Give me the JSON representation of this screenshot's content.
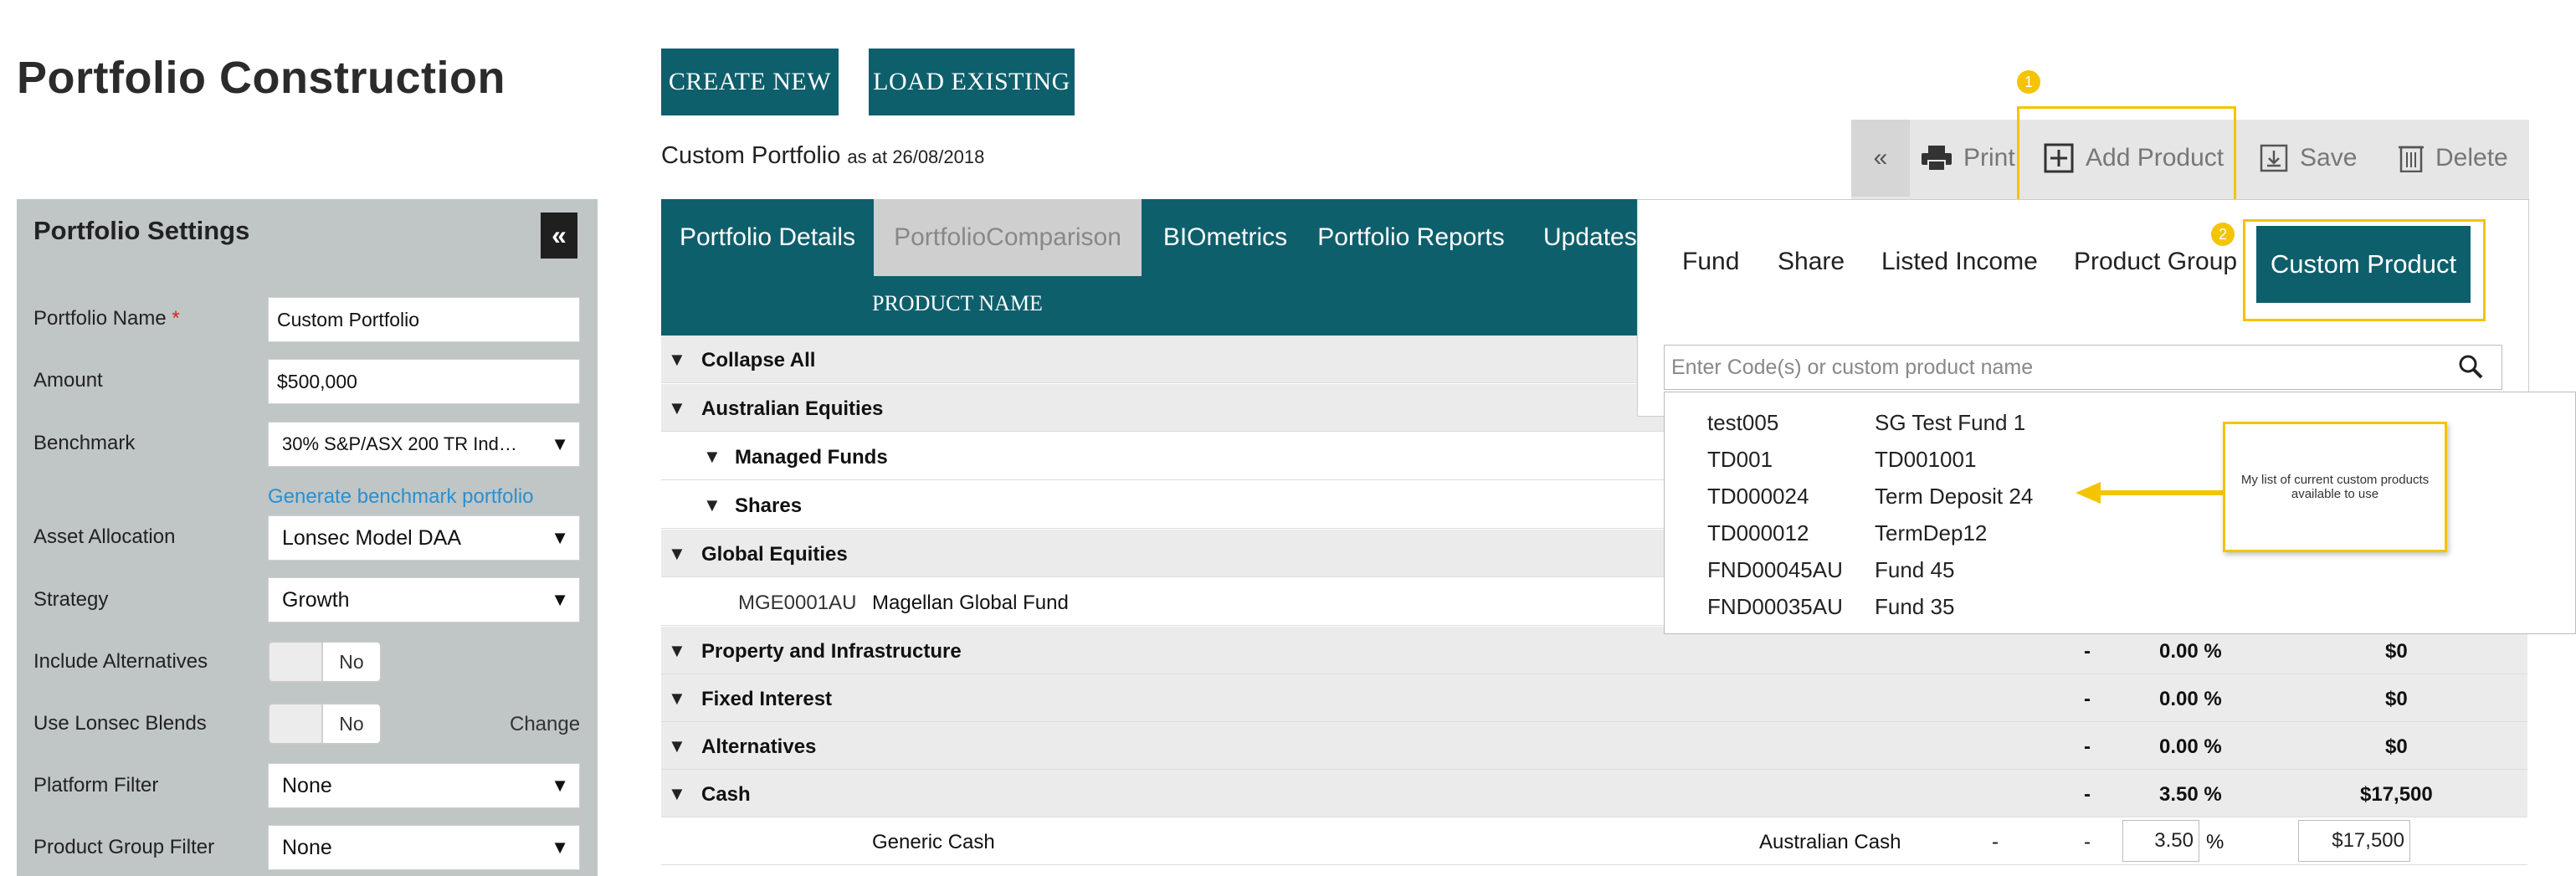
{
  "page": {
    "title": "Portfolio Construction"
  },
  "header_buttons": {
    "create_new": "CREATE NEW",
    "load_existing": "LOAD EXISTING"
  },
  "portfolio_heading": {
    "name": "Custom Portfolio",
    "as_at": "as at 26/08/2018"
  },
  "toolbar": {
    "collapse": "«",
    "print": "Print",
    "add_product": "Add Product",
    "save": "Save",
    "delete": "Delete",
    "badge_1": "1",
    "badge_2": "2"
  },
  "settings": {
    "title": "Portfolio Settings",
    "collapse": "«",
    "portfolio_name_label": "Portfolio Name",
    "required_mark": "*",
    "portfolio_name_value": "Custom Portfolio",
    "amount_label": "Amount",
    "amount_value": "$500,000",
    "benchmark_label": "Benchmark",
    "benchmark_value": "30% S&P/ASX 200 TR Ind…",
    "generate_link": "Generate benchmark portfolio",
    "asset_allocation_label": "Asset Allocation",
    "asset_allocation_value": "Lonsec Model DAA",
    "strategy_label": "Strategy",
    "strategy_value": "Growth",
    "include_alternatives_label": "Include Alternatives",
    "include_alternatives_value": "No",
    "use_lonsec_blends_label": "Use Lonsec Blends",
    "use_lonsec_blends_value": "No",
    "change_link": "Change",
    "platform_filter_label": "Platform Filter",
    "platform_filter_value": "None",
    "product_group_filter_label": "Product Group Filter",
    "product_group_filter_value": "None"
  },
  "tabs": [
    {
      "label": "Portfolio Details",
      "active": true
    },
    {
      "label": "PortfolioComparison",
      "active": false
    },
    {
      "label": "BIOmetrics",
      "active": false
    },
    {
      "label": "Portfolio Reports",
      "active": false
    },
    {
      "label": "Updates",
      "active": false
    }
  ],
  "grid": {
    "product_name_header": "PRODUCT NAME",
    "rows": [
      {
        "label": "Collapse All"
      },
      {
        "label": "Australian Equities"
      },
      {
        "label": "Managed Funds"
      },
      {
        "label": "Shares"
      },
      {
        "label": "Global Equities"
      },
      {
        "code": "MGE0001AU",
        "name": "Magellan Global Fund"
      },
      {
        "label": "Property and Infrastructure",
        "dash": "-",
        "pct": "0.00 %",
        "amount": "$0"
      },
      {
        "label": "Fixed Interest",
        "dash": "-",
        "pct": "0.00 %",
        "amount": "$0"
      },
      {
        "label": "Alternatives",
        "dash": "-",
        "pct": "0.00 %",
        "amount": "$0"
      },
      {
        "label": "Cash",
        "dash": "-",
        "pct": "3.50 %",
        "amount": "$17,500"
      },
      {
        "name": "Generic Cash",
        "asset_class": "Australian Cash",
        "dash1": "-",
        "dash2": "-",
        "pct_input": "3.50",
        "pct_sign": "%",
        "amount_input": "$17,500"
      }
    ]
  },
  "add_product_panel": {
    "types": [
      "Fund",
      "Share",
      "Listed Income",
      "Product Group",
      "Custom Product"
    ],
    "search_placeholder": "Enter Code(s) or custom product name",
    "results": [
      {
        "code": "test005",
        "name": "SG Test Fund 1"
      },
      {
        "code": "TD001",
        "name": "TD001001"
      },
      {
        "code": "TD000024",
        "name": "Term Deposit 24"
      },
      {
        "code": "TD000012",
        "name": "TermDep12"
      },
      {
        "code": "FND00045AU",
        "name": "Fund 45"
      },
      {
        "code": "FND00035AU",
        "name": "Fund 35"
      }
    ],
    "callout": "My list of current custom products available to use"
  },
  "colors": {
    "teal": "#0e5f6c",
    "highlight": "#f4c400",
    "link": "#2a8fd2"
  }
}
